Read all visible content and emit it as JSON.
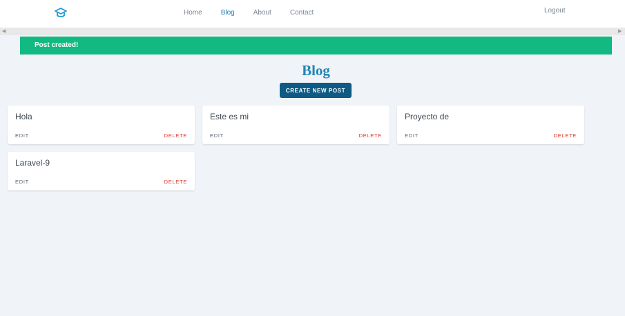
{
  "nav": {
    "links": [
      "Home",
      "Blog",
      "About",
      "Contact"
    ],
    "active": "Blog",
    "logout_label": "Logout"
  },
  "alert": {
    "message": "Post created!"
  },
  "page": {
    "title": "Blog",
    "create_button_label": "CREATE NEW POST"
  },
  "posts": [
    {
      "title": "Hola",
      "edit_label": "EDIT",
      "delete_label": "DELETE"
    },
    {
      "title": "Este es mi",
      "edit_label": "EDIT",
      "delete_label": "DELETE"
    },
    {
      "title": "Proyecto de",
      "edit_label": "EDIT",
      "delete_label": "DELETE"
    },
    {
      "title": "Laravel-9",
      "edit_label": "EDIT",
      "delete_label": "DELETE"
    }
  ],
  "icons": {
    "logo": "graduation-cap-icon",
    "scroll_left": "triangle-left-icon",
    "scroll_right": "triangle-right-icon"
  },
  "colors": {
    "accent": "#1e7fb8",
    "alert_bg": "#12b981",
    "button_bg": "#0e5a84",
    "delete": "#e0362a",
    "page_bg": "#f0f3f7"
  }
}
